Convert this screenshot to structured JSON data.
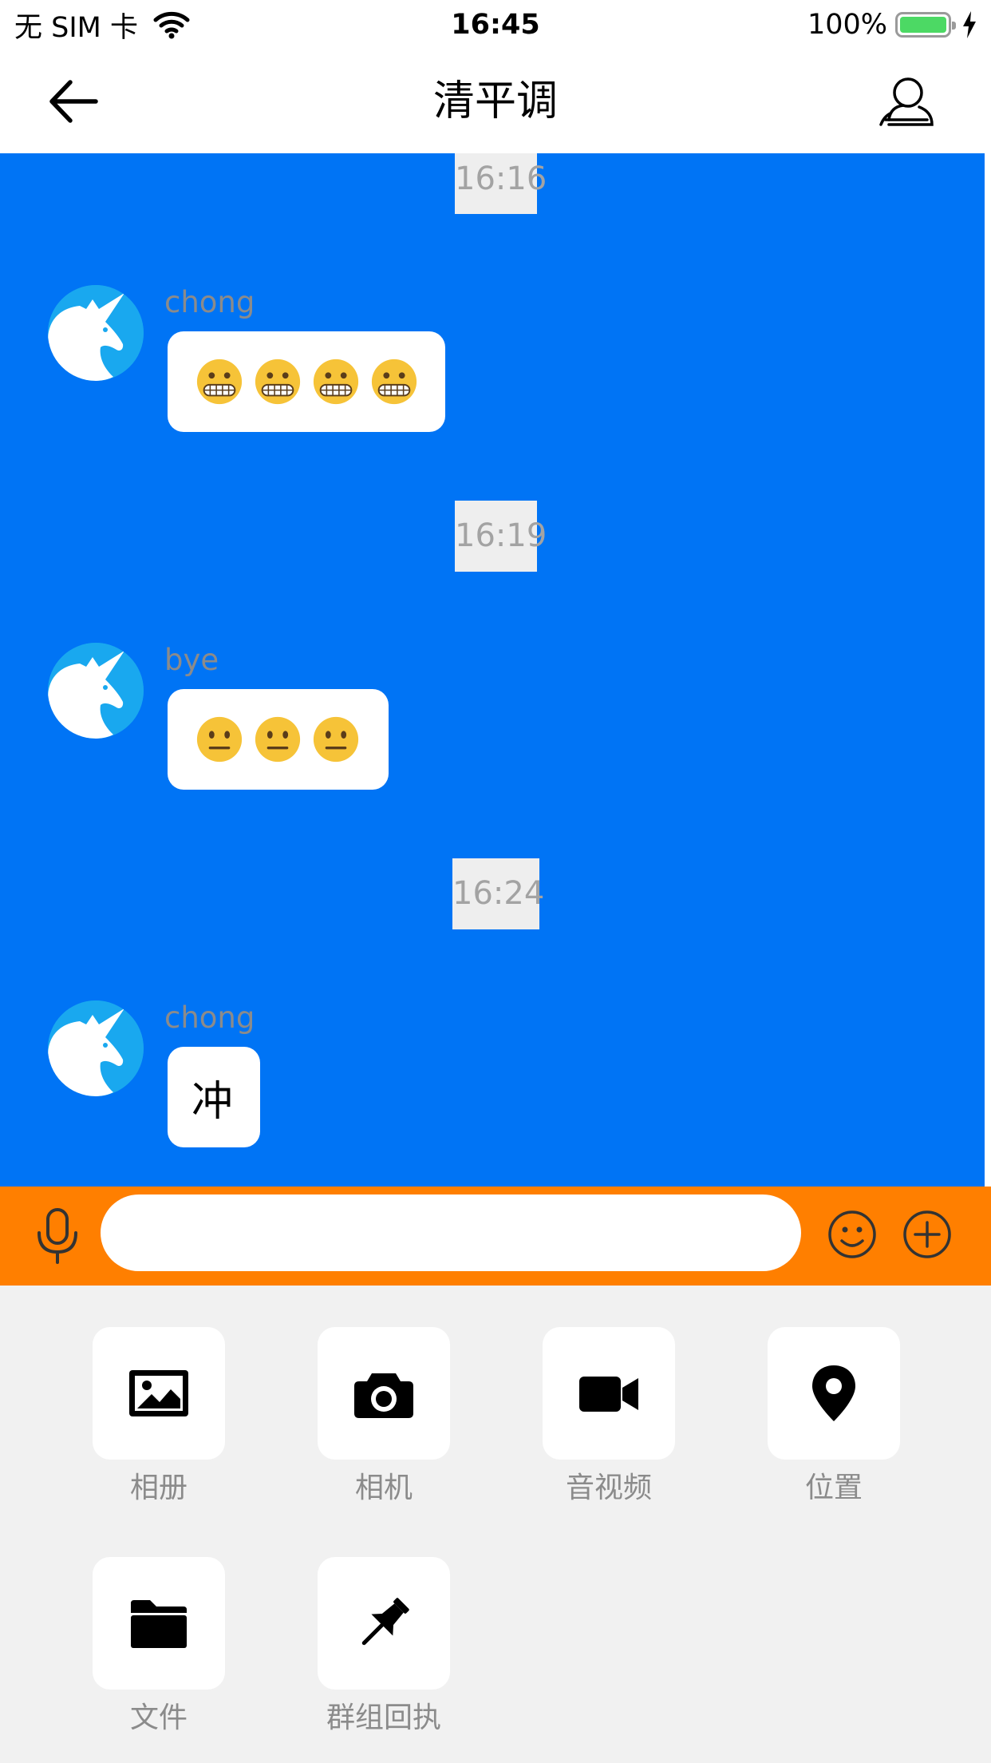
{
  "status_bar": {
    "carrier": "无 SIM 卡",
    "time": "16:45",
    "battery": "100%"
  },
  "nav": {
    "title": "清平调"
  },
  "messages": [
    {
      "time": "16:16",
      "sender": "chong",
      "content": "😬😬😬😬",
      "emoji_type": "grimacing-face",
      "emoji_count": 4
    },
    {
      "time": "16:19",
      "sender": "bye",
      "content": "😐😐😐",
      "emoji_type": "neutral-face",
      "emoji_count": 3
    },
    {
      "time": "16:24",
      "sender": "chong",
      "content": "冲"
    }
  ],
  "input": {
    "value": "",
    "placeholder": ""
  },
  "tools": [
    {
      "label": "相册",
      "icon": "image-icon"
    },
    {
      "label": "相机",
      "icon": "camera-icon"
    },
    {
      "label": "音视频",
      "icon": "video-camera-icon"
    },
    {
      "label": "位置",
      "icon": "location-pin-icon"
    },
    {
      "label": "文件",
      "icon": "folder-icon"
    },
    {
      "label": "群组回执",
      "icon": "pushpin-icon"
    }
  ],
  "colors": {
    "chat_background": "#0074f5",
    "input_bar": "#ff7f00",
    "tools_panel": "#f1f1f1",
    "avatar": "#19a8ef",
    "battery": "#4cd964"
  }
}
